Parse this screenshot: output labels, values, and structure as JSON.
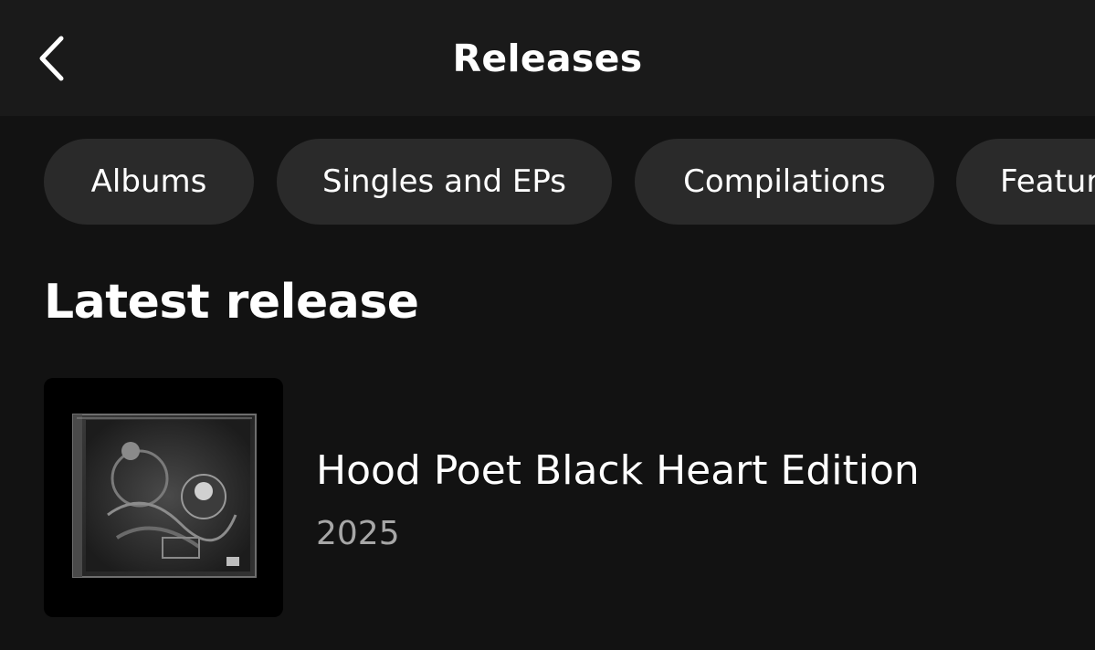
{
  "header": {
    "title": "Releases",
    "back_icon": "chevron-left-icon"
  },
  "filters": [
    {
      "label": "Albums"
    },
    {
      "label": "Singles and EPs"
    },
    {
      "label": "Compilations"
    },
    {
      "label": "Featur"
    }
  ],
  "latest": {
    "section_title": "Latest release",
    "release": {
      "title": "Hood Poet Black Heart Edition",
      "year": "2025",
      "cover_icon": "album-cover-image"
    }
  },
  "colors": {
    "background": "#121212",
    "header_background": "#1a1a1a",
    "chip_background": "#2a2a2a",
    "primary_text": "#ffffff",
    "secondary_text": "#a7a7a7"
  }
}
